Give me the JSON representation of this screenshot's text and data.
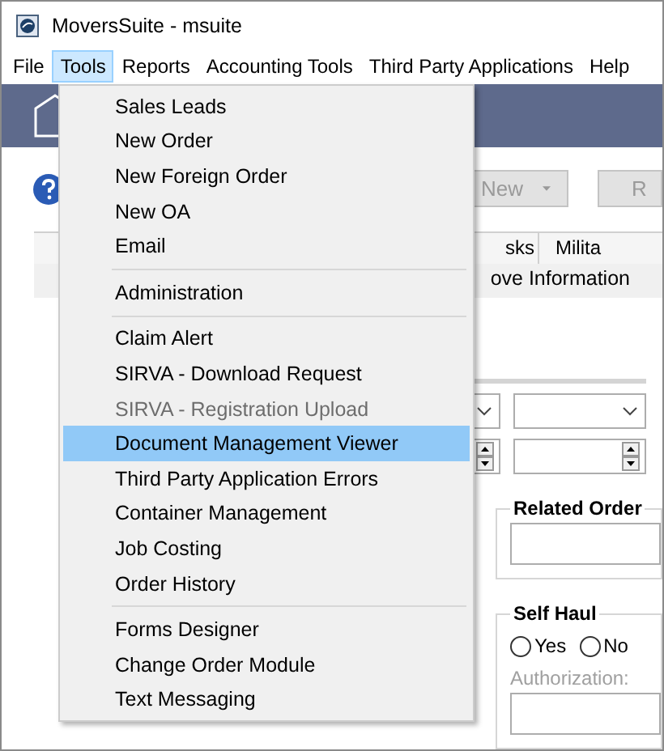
{
  "window": {
    "title": "MoversSuite - msuite"
  },
  "menubar": [
    {
      "label": "File",
      "selected": false
    },
    {
      "label": "Tools",
      "selected": true
    },
    {
      "label": "Reports",
      "selected": false
    },
    {
      "label": "Accounting Tools",
      "selected": false
    },
    {
      "label": "Third Party Applications",
      "selected": false
    },
    {
      "label": "Help",
      "selected": false
    }
  ],
  "toolbar": {
    "buttons": [
      {
        "label": "New",
        "disabled": true
      },
      {
        "label": "R",
        "disabled": true
      }
    ]
  },
  "tabs": [
    {
      "label": "sks"
    },
    {
      "label": "Milita"
    }
  ],
  "subtab": {
    "label": "ove Information"
  },
  "related_order": {
    "title": "Related Order"
  },
  "self_haul": {
    "title": "Self Haul",
    "options": [
      {
        "label": "Yes",
        "selected": false
      },
      {
        "label": "No",
        "selected": false
      }
    ],
    "authorization": {
      "label": "Authorization:",
      "disabled": true
    }
  },
  "tools_menu": {
    "groups": [
      [
        {
          "label": "Sales Leads",
          "selected": false,
          "disabled": false
        },
        {
          "label": "New Order",
          "selected": false,
          "disabled": false
        },
        {
          "label": "New Foreign Order",
          "selected": false,
          "disabled": false
        },
        {
          "label": "New OA",
          "selected": false,
          "disabled": false
        },
        {
          "label": "Email",
          "selected": false,
          "disabled": false
        }
      ],
      [
        {
          "label": "Administration",
          "selected": false,
          "disabled": false
        }
      ],
      [
        {
          "label": "Claim Alert",
          "selected": false,
          "disabled": false
        },
        {
          "label": "SIRVA - Download Request",
          "selected": false,
          "disabled": false
        },
        {
          "label": "SIRVA - Registration Upload",
          "selected": false,
          "disabled": true
        },
        {
          "label": "Document Management Viewer",
          "selected": true,
          "disabled": false
        },
        {
          "label": "Third Party Application Errors",
          "selected": false,
          "disabled": false
        },
        {
          "label": "Container Management",
          "selected": false,
          "disabled": false
        },
        {
          "label": "Job Costing",
          "selected": false,
          "disabled": false
        },
        {
          "label": "Order History",
          "selected": false,
          "disabled": false
        }
      ],
      [
        {
          "label": "Forms Designer",
          "selected": false,
          "disabled": false
        },
        {
          "label": "Change Order Module",
          "selected": false,
          "disabled": false
        },
        {
          "label": "Text Messaging",
          "selected": false,
          "disabled": false
        }
      ]
    ]
  }
}
